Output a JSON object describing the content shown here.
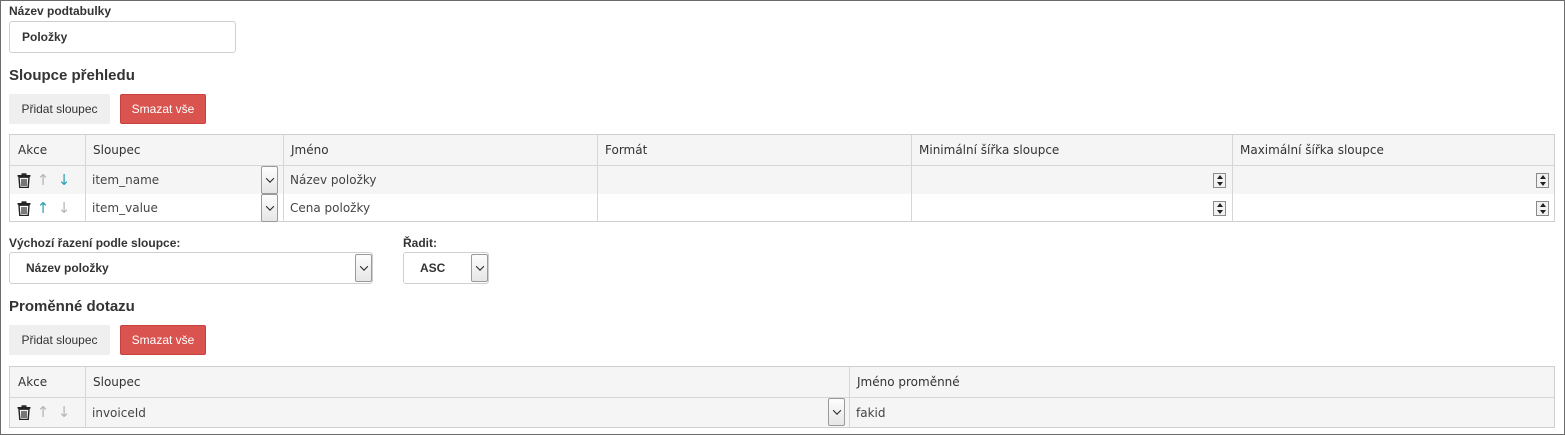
{
  "subtable": {
    "name_label": "Název podtabulky",
    "name_value": "Položky"
  },
  "overview": {
    "heading": "Sloupce přehledu",
    "add_label": "Přidat sloupec",
    "clear_label": "Smazat vše",
    "headers": {
      "actions": "Akce",
      "column": "Sloupec",
      "name": "Jméno",
      "format": "Formát",
      "min_width": "Minimální šířka sloupce",
      "max_width": "Maximální šířka sloupce"
    },
    "rows": [
      {
        "column": "item_name",
        "name": "Název položky",
        "format": "",
        "min_width": "",
        "max_width": "",
        "up_enabled": false,
        "down_enabled": true
      },
      {
        "column": "item_value",
        "name": "Cena položky",
        "format": "",
        "min_width": "",
        "max_width": "",
        "up_enabled": true,
        "down_enabled": false
      }
    ]
  },
  "sorting": {
    "default_label": "Výchozí řazení podle sloupce:",
    "default_value": "Název položky",
    "order_label": "Řadit:",
    "order_value": "ASC"
  },
  "query_vars": {
    "heading": "Proměnné dotazu",
    "add_label": "Přidat sloupec",
    "clear_label": "Smazat vše",
    "headers": {
      "actions": "Akce",
      "column": "Sloupec",
      "var_name": "Jméno proměnné"
    },
    "rows": [
      {
        "column": "invoiceId",
        "var_name": "fakid",
        "up_enabled": false,
        "down_enabled": false
      }
    ]
  },
  "colors": {
    "danger": "#d9534f",
    "default_button": "#efefef",
    "arrow_active": "#2a9fb8",
    "arrow_disabled": "#b5b5b5"
  },
  "icons": [
    "trash-icon",
    "arrow-up-icon",
    "arrow-down-icon",
    "chevron-down-icon",
    "spinner-icon"
  ]
}
